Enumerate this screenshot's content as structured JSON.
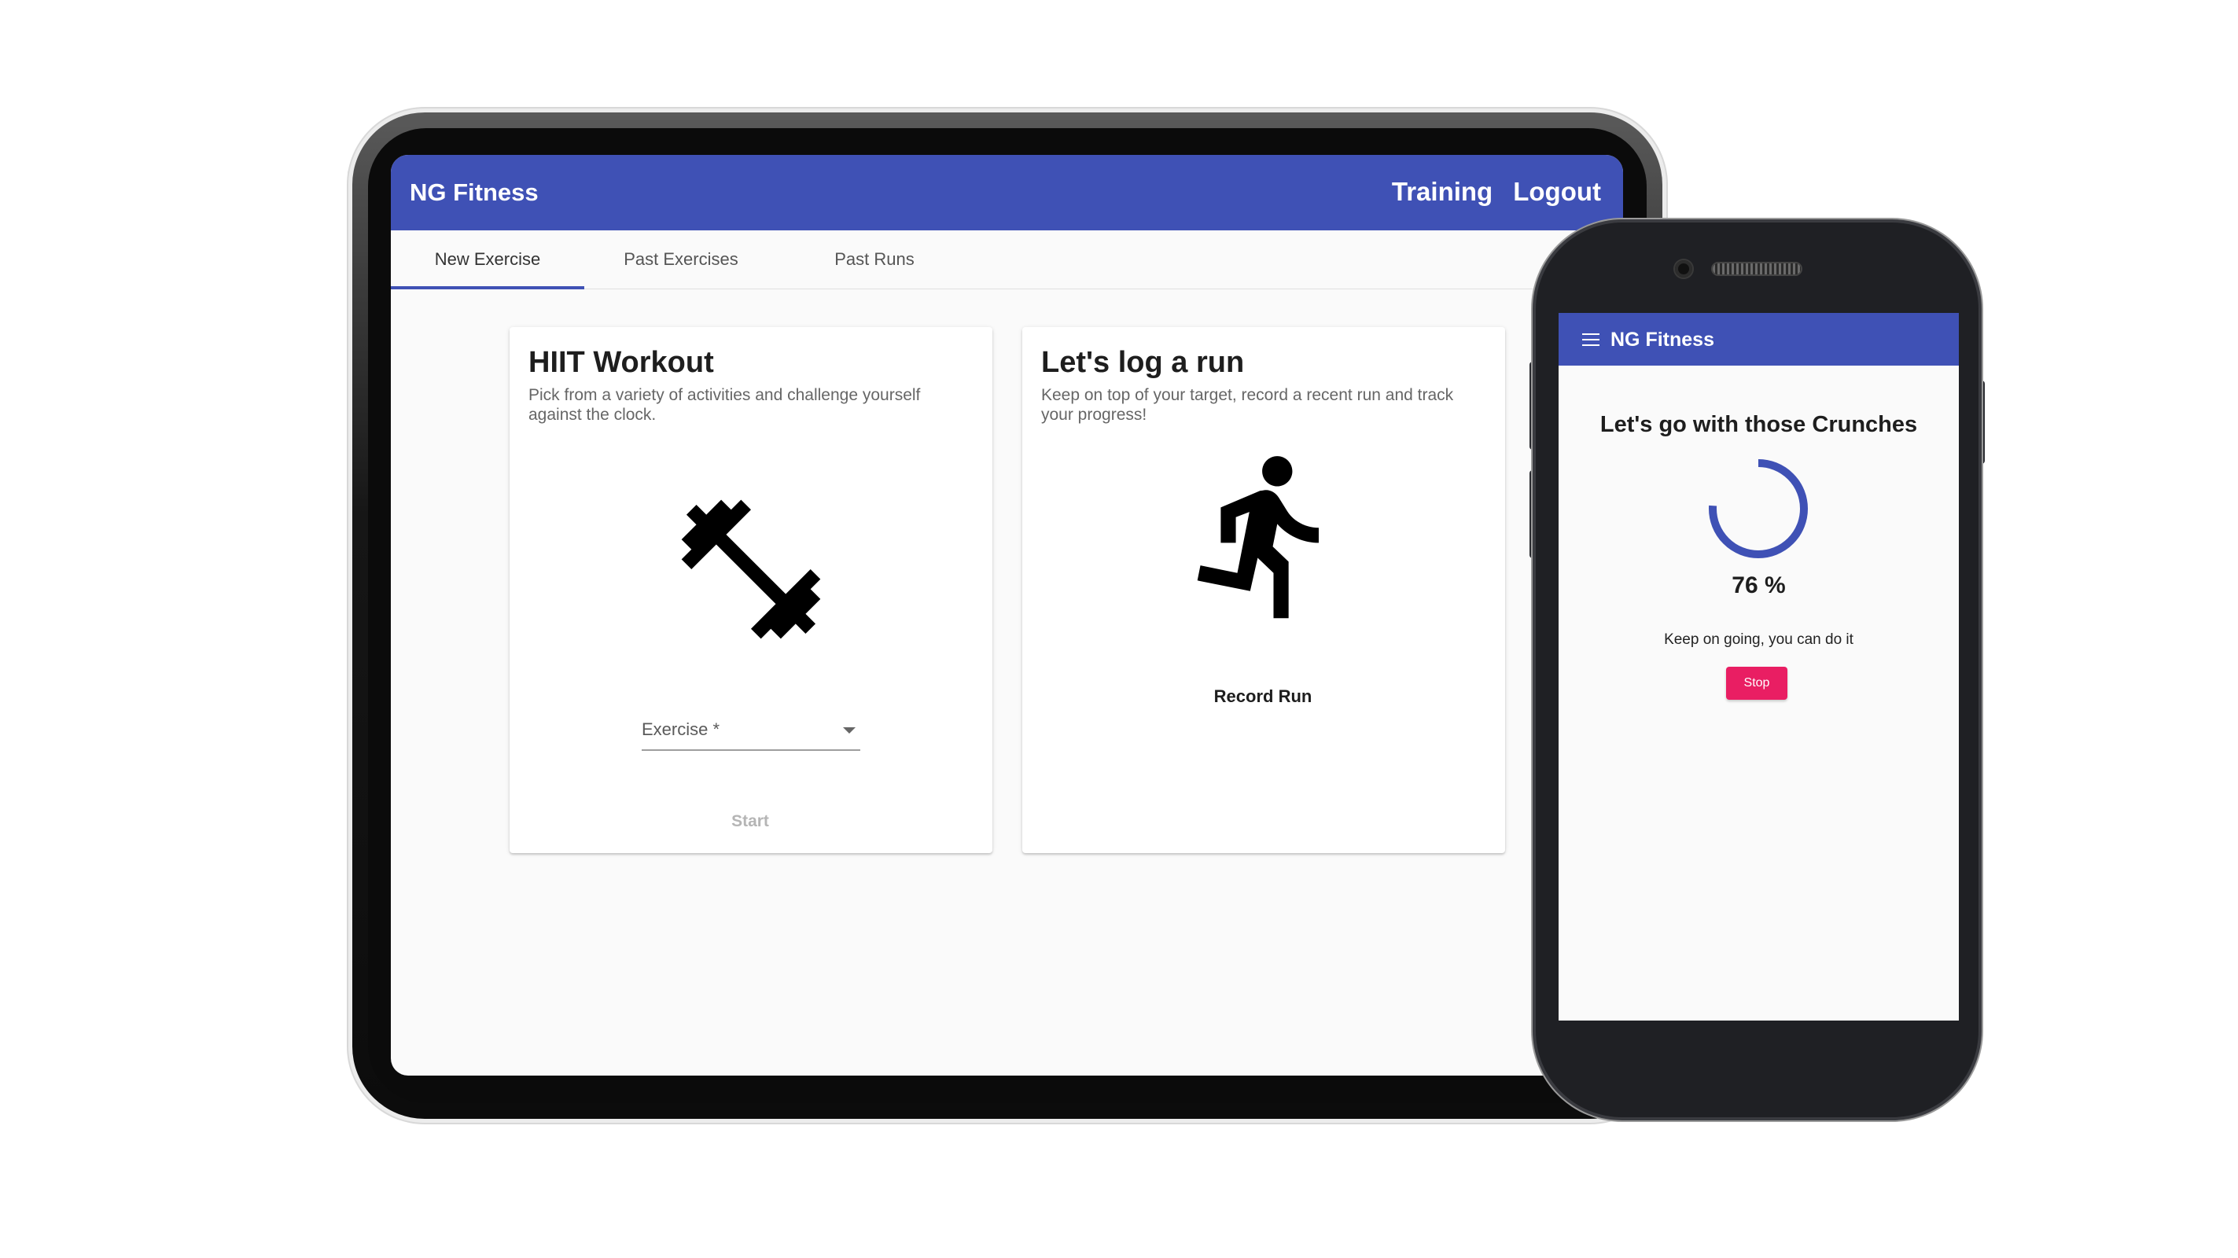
{
  "colors": {
    "primary": "#3f51b5",
    "accent": "#e91e63",
    "background": "#fafafa"
  },
  "tablet": {
    "toolbar": {
      "brand": "NG Fitness",
      "nav": [
        "Training",
        "Logout"
      ]
    },
    "tabs": [
      {
        "label": "New Exercise",
        "active": true
      },
      {
        "label": "Past Exercises",
        "active": false
      },
      {
        "label": "Past Runs",
        "active": false
      }
    ],
    "hiit_card": {
      "title": "HIIT Workout",
      "subtitle": "Pick from a variety of activities and challenge yourself against the clock.",
      "icon": "dumbbell-icon",
      "select_label": "Exercise *",
      "start_label": "Start"
    },
    "run_card": {
      "title": "Let's log a run",
      "subtitle": "Keep on top of your target, record a recent run and track your progress!",
      "icon": "running-person-icon",
      "record_label": "Record Run"
    }
  },
  "phone": {
    "toolbar": {
      "brand": "NG Fitness",
      "menu_icon": "hamburger-menu-icon"
    },
    "heading": "Let's go with those Crunches",
    "progress_value": 76,
    "progress_text": "76 %",
    "message": "Keep on going, you can do it",
    "stop_label": "Stop"
  }
}
